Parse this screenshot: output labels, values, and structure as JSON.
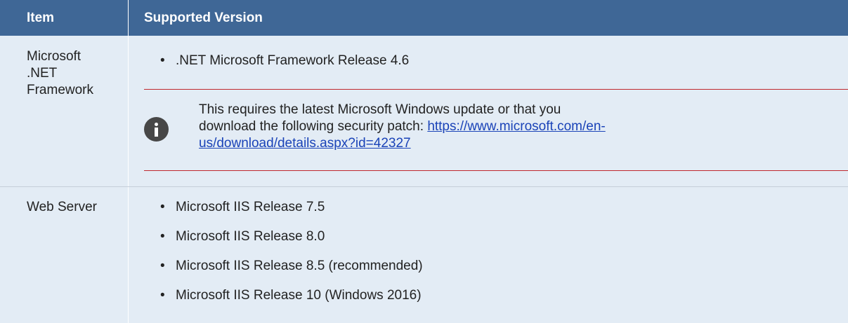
{
  "header": {
    "item_label": "Item",
    "version_label": "Supported Version"
  },
  "rows": [
    {
      "item": "Microsoft .NET Framework",
      "item_lines": [
        "Microsoft",
        ".NET",
        "Framework"
      ],
      "bullets": [
        ".NET Microsoft Framework Release 4.6"
      ],
      "note": {
        "icon": "info-icon",
        "text": "This requires the latest Microsoft Windows update or that you download the following security patch: ",
        "link": "https://www.microsoft.com/en-us/download/details.aspx?id=42327",
        "link_line1": "https://www.microsoft.com/en-",
        "link_line2": "us/download/details.aspx?id=42327"
      }
    },
    {
      "item": "Web Server",
      "bullets": [
        "Microsoft IIS Release 7.5",
        "Microsoft IIS Release 8.0",
        "Microsoft IIS Release 8.5 (recommended)",
        "Microsoft IIS Release 10 (Windows 2016)"
      ]
    }
  ],
  "colors": {
    "header_bg": "#3f6796",
    "row_bg": "#e3ecf5",
    "note_rule": "#c0272d",
    "link": "#1a43b8",
    "icon_bg": "#474747"
  }
}
